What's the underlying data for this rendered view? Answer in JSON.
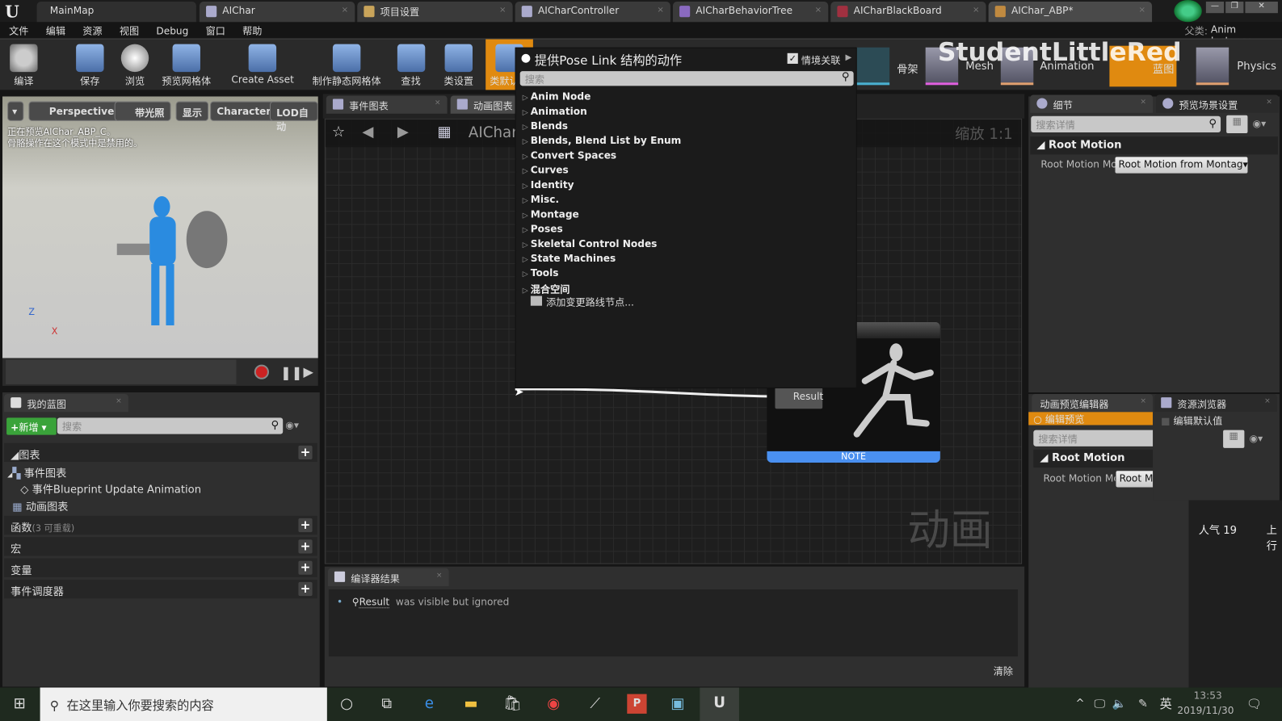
{
  "titlebar": {
    "tabs": [
      {
        "label": "MainMap"
      },
      {
        "label": "AIChar"
      },
      {
        "label": "项目设置"
      },
      {
        "label": "AICharController"
      },
      {
        "label": "AICharBehaviorTree"
      },
      {
        "label": "AICharBlackBoard"
      },
      {
        "label": "AIChar_ABP*"
      }
    ]
  },
  "menubar": [
    "文件",
    "编辑",
    "资源",
    "视图",
    "Debug",
    "窗口",
    "帮助"
  ],
  "parent_class": {
    "label": "父类:",
    "value": "Anim Instance"
  },
  "toolbar": [
    "编译",
    "保存",
    "浏览",
    "预览网格体",
    "Create Asset",
    "制作静态网格体",
    "查找",
    "类设置",
    "类默认值"
  ],
  "modes": [
    "骨架",
    "Mesh",
    "Animation",
    "蓝图",
    "Physics"
  ],
  "watermark": "StudentLittleRed",
  "viewport": {
    "buttons": [
      "Perspective",
      "带光照",
      "显示",
      "Character",
      "LOD自动"
    ],
    "message": [
      "正在预览AIChar_ABP_C。",
      "骨骼操作在这个模式中是禁用的。"
    ],
    "axes": [
      "Z",
      "X"
    ]
  },
  "my_blueprint": {
    "tab": "我的蓝图",
    "add_label": "新增",
    "search_placeholder": "搜索",
    "graphs": "图表",
    "event_graph": "事件图表",
    "event_item": "事件Blueprint Update Animation",
    "anim_graph": "动画图表",
    "functions": "函数",
    "functions_note": "(3 可重载)",
    "macros": "宏",
    "variables": "变量",
    "dispatchers": "事件调度器"
  },
  "graph": {
    "tabs": [
      "事件图表",
      "动画图表"
    ],
    "breadcrumb": "AIChar",
    "zoom": "缩放 1:1",
    "result_pin": "Result",
    "note": "NOTE",
    "watermark": "动画"
  },
  "context_menu": {
    "title": "提供Pose Link 结构的动作",
    "context_sensitive": "情境关联",
    "context_checked": true,
    "search_placeholder": "搜索",
    "items": [
      "Anim Node",
      "Animation",
      "Blends",
      "Blends, Blend List by Enum",
      "Convert Spaces",
      "Curves",
      "Identity",
      "Misc.",
      "Montage",
      "Poses",
      "Skeletal Control Nodes",
      "State Machines",
      "Tools",
      "混合空间"
    ],
    "add_reroute": "添加变更路线节点..."
  },
  "compiler": {
    "tab": "编译器结果",
    "message_link": "Result",
    "message": "was visible but ignored",
    "clear": "清除"
  },
  "details": {
    "tabs": [
      "细节",
      "预览场景设置"
    ],
    "search_placeholder": "搜索详情",
    "section": "Root Motion",
    "prop_label": "Root Motion Mode",
    "prop_value": "Root Motion from Montag"
  },
  "anim_preview": {
    "tabs": [
      "动画预览编辑器",
      "资源浏览器"
    ],
    "edit_preview": "编辑预览",
    "edit_defaults": "编辑默认值",
    "search_placeholder": "搜索详情",
    "section": "Root Motion",
    "prop_label": "Root Motion Mode",
    "prop_value": "Root Motion from Montag"
  },
  "overlay": {
    "popularity": "人气 19",
    "extra": "上行"
  },
  "taskbar": {
    "search_placeholder": "在这里输入你要搜索的内容",
    "ime": "英",
    "time": "13:53",
    "date": "2019/11/30"
  },
  "colors": {
    "accent_orange": "#e08a10",
    "note_blue": "#4a90f0",
    "add_green": "#3aa33a"
  }
}
